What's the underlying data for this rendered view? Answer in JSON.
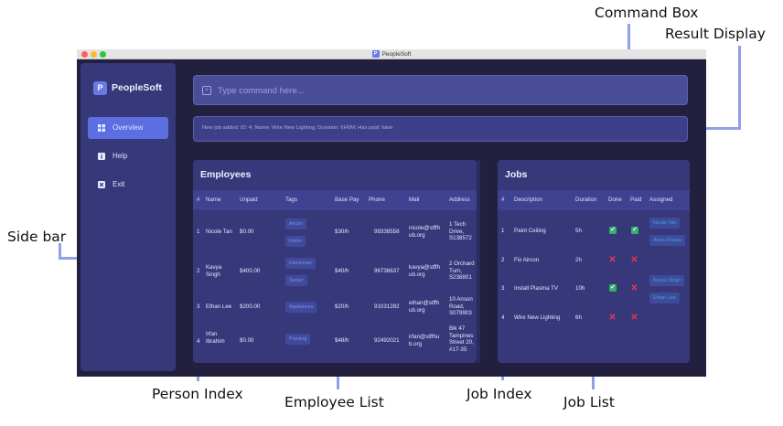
{
  "annotations": {
    "command_box": "Command Box",
    "result_display": "Result Display",
    "side_bar": "Side bar",
    "person_index": "Person Index",
    "employee_list": "Employee List",
    "job_index": "Job Index",
    "job_list": "Job List"
  },
  "window": {
    "title": "PeopleSoft",
    "icon_letter": "P"
  },
  "sidebar": {
    "brand": "PeopleSoft",
    "brand_letter": "P",
    "items": [
      {
        "label": "Overview",
        "icon": "grid-icon",
        "active": true
      },
      {
        "label": "Help",
        "icon": "info-icon",
        "active": false
      },
      {
        "label": "Exit",
        "icon": "close-box-icon",
        "active": false
      }
    ]
  },
  "command": {
    "placeholder": "Type command here..."
  },
  "result": {
    "text": "New job added: ID: 4; Name: Wire New Lighting; Duration: 6H0M; Has paid: false"
  },
  "employees": {
    "title": "Employees",
    "columns": [
      "#",
      "Name",
      "Unpaid",
      "Tags",
      "Base Pay",
      "Phone",
      "Mail",
      "Address"
    ],
    "rows": [
      {
        "index": "1",
        "name": "Nicole Tan",
        "unpaid": "$0.00",
        "tags": [
          "Aircon",
          "Intern"
        ],
        "base_pay": "$30/h",
        "phone": "99338558",
        "mail": "nicole@stffh ub.org",
        "address": "1 Tech Drive, S138572"
      },
      {
        "index": "2",
        "name": "Kavya Singh",
        "unpaid": "$400.00",
        "tags": [
          "Electrician",
          "Senior"
        ],
        "base_pay": "$40/h",
        "phone": "96736637",
        "mail": "kavya@stffh ub.org",
        "address": "2 Orchard Turn, S238801"
      },
      {
        "index": "3",
        "name": "Ethan Lee",
        "unpaid": "$200.00",
        "tags": [
          "Appliances"
        ],
        "base_pay": "$20/h",
        "phone": "91031282",
        "mail": "ethan@stffh ub.org",
        "address": "10 Anson Road, S079903"
      },
      {
        "index": "4",
        "name": "Irfan Ibrahim",
        "unpaid": "$0.00",
        "tags": [
          "Painting"
        ],
        "base_pay": "$48/h",
        "phone": "92492021",
        "mail": "irfan@stffhu b.org",
        "address": "Blk 47 Tampines Street 20, #17-35"
      }
    ]
  },
  "jobs": {
    "title": "Jobs",
    "columns": [
      "#",
      "Description",
      "Duration",
      "Done",
      "Paid",
      "Assigned"
    ],
    "rows": [
      {
        "index": "1",
        "description": "Paint Ceiling",
        "duration": "5h",
        "done": true,
        "paid": true,
        "assigned": [
          "Nicole Tan",
          "Arjun Khatau"
        ]
      },
      {
        "index": "2",
        "description": "Fix Aircon",
        "duration": "2h",
        "done": false,
        "paid": false,
        "assigned": []
      },
      {
        "index": "3",
        "description": "Install Plasma TV",
        "duration": "10h",
        "done": true,
        "paid": false,
        "assigned": [
          "Kavya Singh",
          "Ethan Lee"
        ]
      },
      {
        "index": "4",
        "description": "Wire New Lighting",
        "duration": "6h",
        "done": false,
        "paid": false,
        "assigned": []
      }
    ]
  },
  "colors": {
    "window_bg": "#23203f",
    "panel_bg": "#36387a",
    "accent": "#5b6fe0",
    "check_green": "#35b070",
    "cross_red": "#e23a52",
    "annotation_line": "#8fa0e6"
  }
}
